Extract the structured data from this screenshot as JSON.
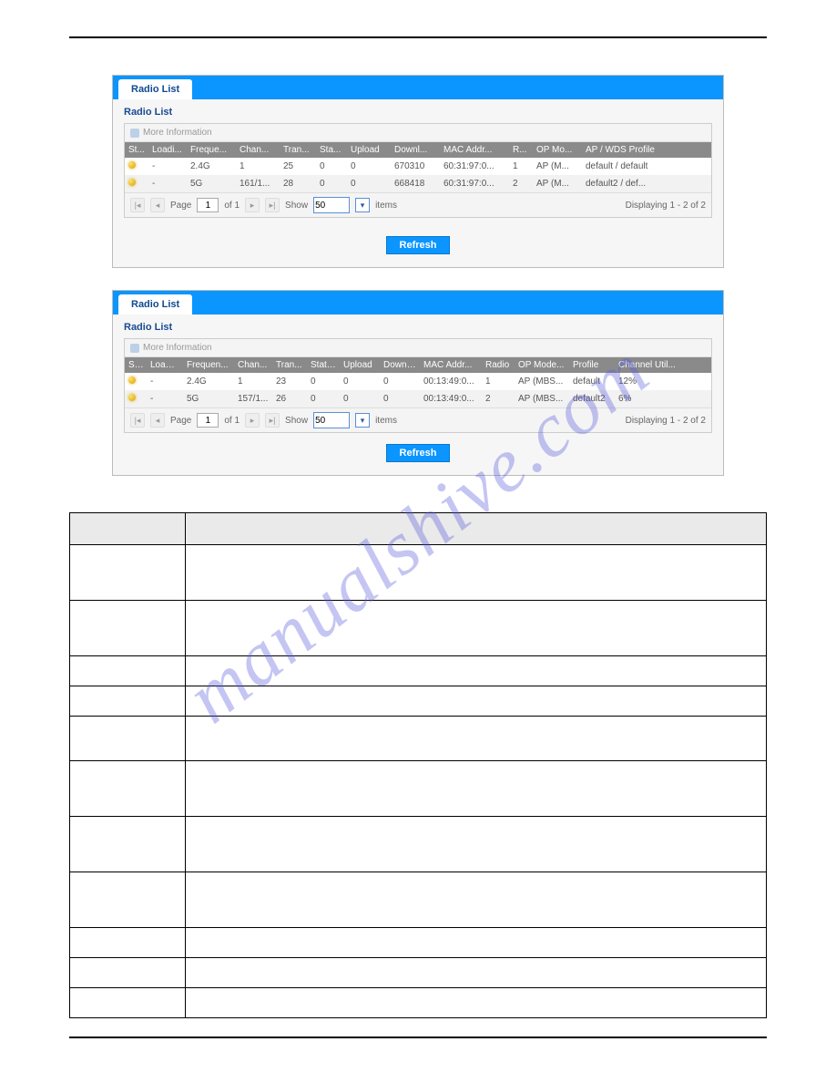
{
  "watermark": "manualshive.com",
  "panel1": {
    "tab": "Radio List",
    "title": "Radio List",
    "more_info": "More Information",
    "headers": [
      "St...",
      "Loadi...",
      "Freque...",
      "Chan...",
      "Tran...",
      "Sta...",
      "Upload",
      "Downl...",
      "MAC Addr...",
      "R...",
      "OP Mo...",
      "AP / WDS Profile"
    ],
    "rows": [
      {
        "loading": "-",
        "freq": "2.4G",
        "chan": "1",
        "trans": "25",
        "stat": "0",
        "upload": "0",
        "downl": "670310",
        "mac": "60:31:97:0...",
        "r": "1",
        "op": "AP (M...",
        "profile": "default / default"
      },
      {
        "loading": "-",
        "freq": "5G",
        "chan": "161/1...",
        "trans": "28",
        "stat": "0",
        "upload": "0",
        "downl": "668418",
        "mac": "60:31:97:0...",
        "r": "2",
        "op": "AP (M...",
        "profile": "default2 / def..."
      }
    ],
    "pager": {
      "page_label": "Page",
      "page": "1",
      "of": "of 1",
      "show": "Show",
      "show_val": "50",
      "items": "items",
      "display": "Displaying 1 - 2 of 2"
    },
    "refresh": "Refresh"
  },
  "panel2": {
    "tab": "Radio List",
    "title": "Radio List",
    "more_info": "More Information",
    "headers": [
      "St...",
      "Loadi...",
      "Frequen...",
      "Chan...",
      "Tran...",
      "Stati...",
      "Upload",
      "Downl...",
      "MAC Addr...",
      "Radio",
      "OP Mode...",
      "Profile",
      "Channel Util..."
    ],
    "rows": [
      {
        "loading": "-",
        "freq": "2.4G",
        "chan": "1",
        "trans": "23",
        "stat": "0",
        "upload": "0",
        "downl": "0",
        "mac": "00:13:49:0...",
        "r": "1",
        "op": "AP (MBS...",
        "profile": "default",
        "util": "12%"
      },
      {
        "loading": "-",
        "freq": "5G",
        "chan": "157/1...",
        "trans": "26",
        "stat": "0",
        "upload": "0",
        "downl": "0",
        "mac": "00:13:49:0...",
        "r": "2",
        "op": "AP (MBS...",
        "profile": "default2",
        "util": "6%"
      }
    ],
    "pager": {
      "page_label": "Page",
      "page": "1",
      "of": "of 1",
      "show": "Show",
      "show_val": "50",
      "items": "items",
      "display": "Displaying 1 - 2 of 2"
    },
    "refresh": "Refresh"
  }
}
